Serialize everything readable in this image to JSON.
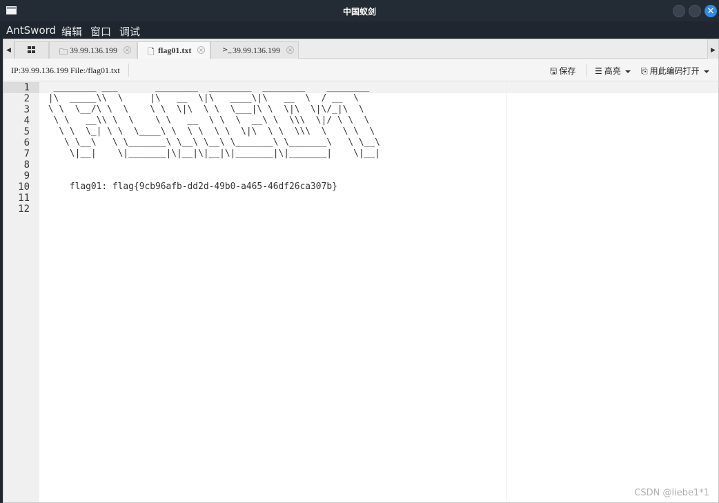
{
  "window": {
    "title": "中国蚁剑"
  },
  "menu": [
    "AntSword",
    "编辑",
    "窗口",
    "调试"
  ],
  "tabs": [
    {
      "icon": "grid-icon",
      "label": ""
    },
    {
      "icon": "folder-icon",
      "label": "39.99.136.199"
    },
    {
      "icon": "file-icon",
      "label": "flag01.txt"
    },
    {
      "icon": "terminal-icon",
      "label": "39.99.136.199"
    }
  ],
  "toolbar": {
    "info": "IP:39.99.136.199 File:/flag01.txt",
    "save_label": "保存",
    "highlight_label": "高亮",
    "encoding_label": "用此编码打开"
  },
  "editor": {
    "line_numbers": [
      "1",
      "2",
      "3",
      "4",
      "5",
      "6",
      "7",
      "8",
      "9",
      "10",
      "11",
      "12"
    ],
    "lines": [
      "  ________ ___       ________  ________  ________    ________",
      " |\\  _____\\\\  \\     |\\   __  \\|\\   ____\\|\\   __  \\  / __  \\",
      " \\ \\  \\__/\\ \\  \\    \\ \\  \\|\\  \\ \\  \\___|\\ \\  \\|\\  \\|\\/_|\\  \\",
      "  \\ \\   __\\\\ \\  \\    \\ \\   __  \\ \\  \\  __\\ \\  \\\\\\  \\|/ \\ \\  \\",
      "   \\ \\  \\_| \\ \\  \\____\\ \\  \\ \\  \\ \\  \\|\\  \\ \\  \\\\\\  \\   \\ \\  \\",
      "    \\ \\__\\   \\ \\_______\\ \\__\\ \\__\\ \\_______\\ \\_______\\   \\ \\__\\",
      "     \\|__|    \\|_______|\\|__|\\|__|\\|_______|\\|_______|    \\|__|",
      "",
      "",
      "     flag01: flag{9cb96afb-dd2d-49b0-a465-46df26ca307b}",
      "",
      ""
    ]
  },
  "watermark": "CSDN @liebe1*1"
}
